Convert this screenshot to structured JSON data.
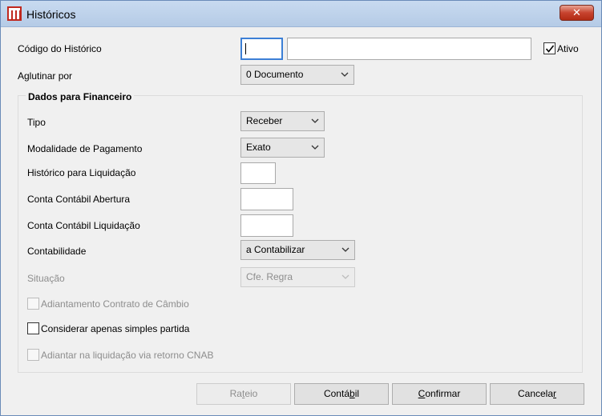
{
  "window": {
    "title": "Históricos",
    "close_glyph": "✕"
  },
  "fields": {
    "codigo_label": "Código do Histórico",
    "codigo_value": "",
    "descricao_value": "",
    "ativo_label": "Ativo",
    "ativo_checked": true,
    "aglutinar_label": "Aglutinar por",
    "aglutinar_value": "0 Documento"
  },
  "financeiro": {
    "group_title": "Dados para Financeiro",
    "tipo_label": "Tipo",
    "tipo_value": "Receber",
    "modalidade_label": "Modalidade de Pagamento",
    "modalidade_value": "Exato",
    "historico_liq_label": "Histórico para Liquidação",
    "conta_abertura_label": "Conta Contábil Abertura",
    "conta_liquidacao_label": "Conta Contábil Liquidação",
    "contabilidade_label": "Contabilidade",
    "contabilidade_value": "a Contabilizar",
    "situacao_label": "Situação",
    "situacao_value": "Cfe. Regra",
    "adiantamento_label": "Adiantamento Contrato de Câmbio",
    "simples_partida_label": "Considerar apenas simples partida",
    "adiantar_cnab_label": "Adiantar na liquidação via retorno CNAB"
  },
  "buttons": {
    "rateio": {
      "pre": "Ra",
      "u": "t",
      "post": "eio"
    },
    "contabil": {
      "pre": "Contá",
      "u": "b",
      "post": "il"
    },
    "confirmar": {
      "pre": "",
      "u": "C",
      "post": "onfirmar"
    },
    "cancelar": {
      "pre": "Cancela",
      "u": "r",
      "post": ""
    }
  },
  "colors": {
    "accent": "#3c7fd6",
    "titlebar": "#b5cbe6",
    "close": "#c7432e",
    "disabled_text": "#8d8d8d"
  }
}
